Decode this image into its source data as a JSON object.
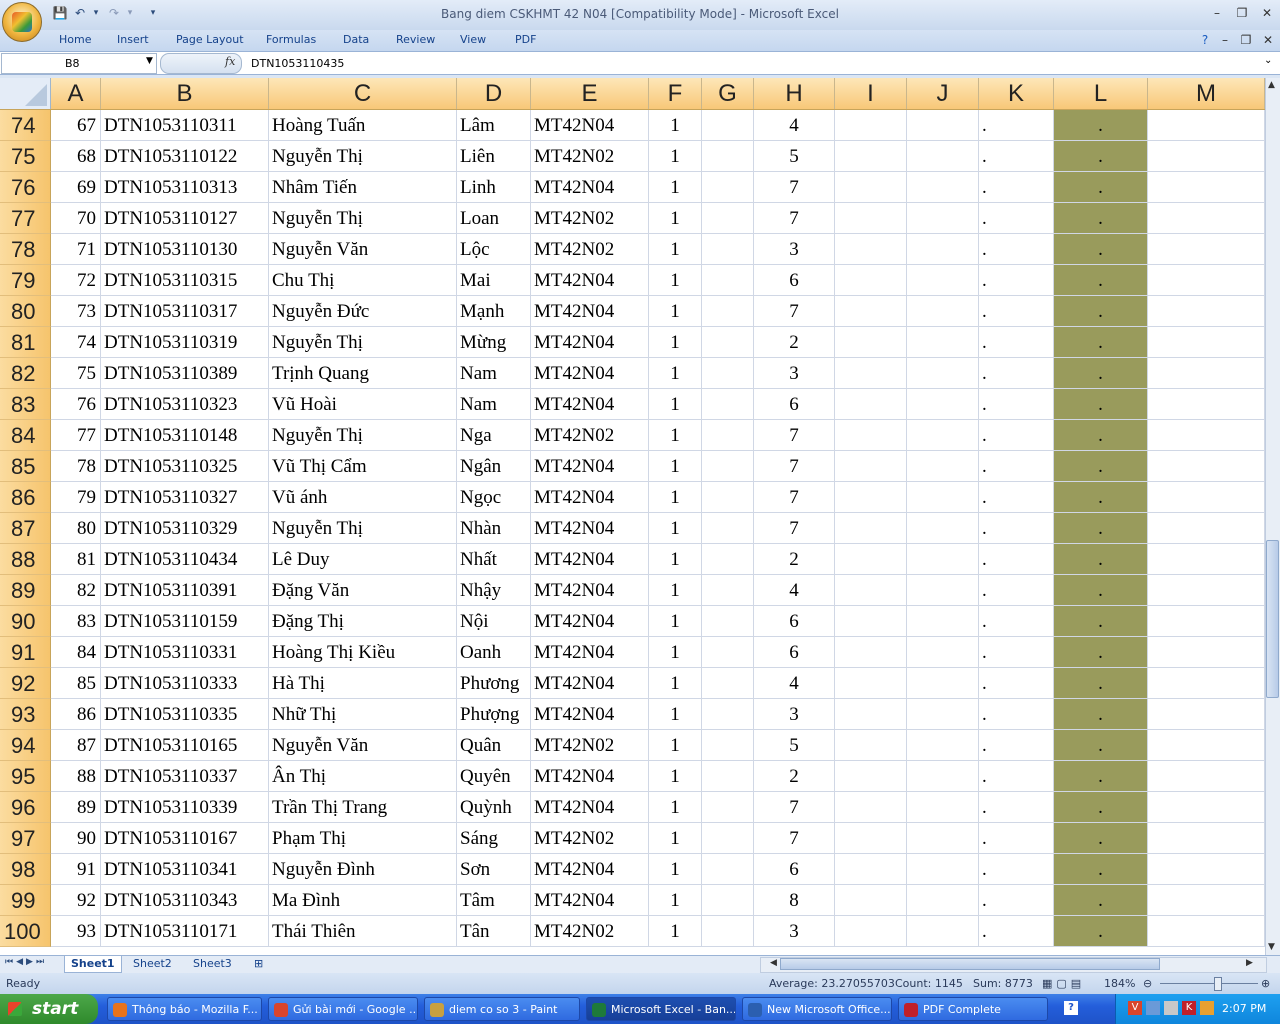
{
  "window": {
    "title": "Bang diem CSKHMT 42 N04  [Compatibility Mode] - Microsoft Excel"
  },
  "ribbon": {
    "tabs": [
      "Home",
      "Insert",
      "Page Layout",
      "Formulas",
      "Data",
      "Review",
      "View",
      "PDF"
    ]
  },
  "formula_bar": {
    "name_box": "B8",
    "fx_label": "fx",
    "value": "DTN1053110435"
  },
  "columns": [
    "A",
    "B",
    "C",
    "D",
    "E",
    "F",
    "G",
    "H",
    "I",
    "J",
    "K",
    "L",
    "M"
  ],
  "rows": [
    {
      "n": "74",
      "a": "67",
      "b": "DTN1053110311",
      "c": "Hoàng Tuấn",
      "d": "Lâm",
      "e": "MT42N04",
      "f": "1",
      "h": "4",
      "k": ".",
      "l": "."
    },
    {
      "n": "75",
      "a": "68",
      "b": "DTN1053110122",
      "c": "Nguyễn Thị",
      "d": "Liên",
      "e": "MT42N02",
      "f": "1",
      "h": "5",
      "k": ".",
      "l": "."
    },
    {
      "n": "76",
      "a": "69",
      "b": "DTN1053110313",
      "c": "Nhâm Tiến",
      "d": "Linh",
      "e": "MT42N04",
      "f": "1",
      "h": "7",
      "k": ".",
      "l": "."
    },
    {
      "n": "77",
      "a": "70",
      "b": "DTN1053110127",
      "c": "Nguyễn Thị",
      "d": "Loan",
      "e": "MT42N02",
      "f": "1",
      "h": "7",
      "k": ".",
      "l": "."
    },
    {
      "n": "78",
      "a": "71",
      "b": "DTN1053110130",
      "c": "Nguyễn Văn",
      "d": "Lộc",
      "e": "MT42N02",
      "f": "1",
      "h": "3",
      "k": ".",
      "l": "."
    },
    {
      "n": "79",
      "a": "72",
      "b": "DTN1053110315",
      "c": "Chu Thị",
      "d": "Mai",
      "e": "MT42N04",
      "f": "1",
      "h": "6",
      "k": ".",
      "l": "."
    },
    {
      "n": "80",
      "a": "73",
      "b": "DTN1053110317",
      "c": "Nguyễn Đức",
      "d": "Mạnh",
      "e": "MT42N04",
      "f": "1",
      "h": "7",
      "k": ".",
      "l": "."
    },
    {
      "n": "81",
      "a": "74",
      "b": "DTN1053110319",
      "c": "Nguyễn Thị",
      "d": "Mừng",
      "e": "MT42N04",
      "f": "1",
      "h": "2",
      "k": ".",
      "l": "."
    },
    {
      "n": "82",
      "a": "75",
      "b": "DTN1053110389",
      "c": "Trịnh Quang",
      "d": "Nam",
      "e": "MT42N04",
      "f": "1",
      "h": "3",
      "k": ".",
      "l": "."
    },
    {
      "n": "83",
      "a": "76",
      "b": "DTN1053110323",
      "c": "Vũ Hoài",
      "d": "Nam",
      "e": "MT42N04",
      "f": "1",
      "h": "6",
      "k": ".",
      "l": "."
    },
    {
      "n": "84",
      "a": "77",
      "b": "DTN1053110148",
      "c": "Nguyễn Thị",
      "d": "Nga",
      "e": "MT42N02",
      "f": "1",
      "h": "7",
      "k": ".",
      "l": "."
    },
    {
      "n": "85",
      "a": "78",
      "b": "DTN1053110325",
      "c": "Vũ Thị Cẩm",
      "d": "Ngân",
      "e": "MT42N04",
      "f": "1",
      "h": "7",
      "k": ".",
      "l": "."
    },
    {
      "n": "86",
      "a": "79",
      "b": "DTN1053110327",
      "c": "Vũ ánh",
      "d": "Ngọc",
      "e": "MT42N04",
      "f": "1",
      "h": "7",
      "k": ".",
      "l": "."
    },
    {
      "n": "87",
      "a": "80",
      "b": "DTN1053110329",
      "c": "Nguyễn Thị",
      "d": "Nhàn",
      "e": "MT42N04",
      "f": "1",
      "h": "7",
      "k": ".",
      "l": "."
    },
    {
      "n": "88",
      "a": "81",
      "b": "DTN1053110434",
      "c": "Lê Duy",
      "d": "Nhất",
      "e": "MT42N04",
      "f": "1",
      "h": "2",
      "k": ".",
      "l": "."
    },
    {
      "n": "89",
      "a": "82",
      "b": "DTN1053110391",
      "c": "Đặng Văn",
      "d": "Nhậy",
      "e": "MT42N04",
      "f": "1",
      "h": "4",
      "k": ".",
      "l": "."
    },
    {
      "n": "90",
      "a": "83",
      "b": "DTN1053110159",
      "c": "Đặng Thị",
      "d": "Nội",
      "e": "MT42N04",
      "f": "1",
      "h": "6",
      "k": ".",
      "l": "."
    },
    {
      "n": "91",
      "a": "84",
      "b": "DTN1053110331",
      "c": "Hoàng Thị Kiều",
      "d": "Oanh",
      "e": "MT42N04",
      "f": "1",
      "h": "6",
      "k": ".",
      "l": "."
    },
    {
      "n": "92",
      "a": "85",
      "b": "DTN1053110333",
      "c": "Hà Thị",
      "d": "Phương",
      "e": "MT42N04",
      "f": "1",
      "h": "4",
      "k": ".",
      "l": "."
    },
    {
      "n": "93",
      "a": "86",
      "b": "DTN1053110335",
      "c": "Nhữ Thị",
      "d": "Phượng",
      "e": "MT42N04",
      "f": "1",
      "h": "3",
      "k": ".",
      "l": "."
    },
    {
      "n": "94",
      "a": "87",
      "b": "DTN1053110165",
      "c": "Nguyễn Văn",
      "d": "Quân",
      "e": "MT42N02",
      "f": "1",
      "h": "5",
      "k": ".",
      "l": "."
    },
    {
      "n": "95",
      "a": "88",
      "b": "DTN1053110337",
      "c": "Ân Thị",
      "d": "Quyên",
      "e": "MT42N04",
      "f": "1",
      "h": "2",
      "k": ".",
      "l": "."
    },
    {
      "n": "96",
      "a": "89",
      "b": "DTN1053110339",
      "c": "Trần Thị Trang",
      "d": "Quỳnh",
      "e": "MT42N04",
      "f": "1",
      "h": "7",
      "k": ".",
      "l": "."
    },
    {
      "n": "97",
      "a": "90",
      "b": "DTN1053110167",
      "c": "Phạm Thị",
      "d": "Sáng",
      "e": "MT42N02",
      "f": "1",
      "h": "7",
      "k": ".",
      "l": "."
    },
    {
      "n": "98",
      "a": "91",
      "b": "DTN1053110341",
      "c": "Nguyễn Đình",
      "d": "Sơn",
      "e": "MT42N04",
      "f": "1",
      "h": "6",
      "k": ".",
      "l": "."
    },
    {
      "n": "99",
      "a": "92",
      "b": "DTN1053110343",
      "c": "Ma Đình",
      "d": "Tâm",
      "e": "MT42N04",
      "f": "1",
      "h": "8",
      "k": ".",
      "l": "."
    },
    {
      "n": "100",
      "a": "93",
      "b": "DTN1053110171",
      "c": "Thái Thiên",
      "d": "Tân",
      "e": "MT42N02",
      "f": "1",
      "h": "3",
      "k": ".",
      "l": "."
    }
  ],
  "sheets": [
    "Sheet1",
    "Sheet2",
    "Sheet3"
  ],
  "status": {
    "ready": "Ready",
    "average": "Average: 23.27055703",
    "count": "Count: 1145",
    "sum": "Sum: 8773",
    "zoom": "184%"
  },
  "taskbar": {
    "start": "start",
    "tasks": [
      {
        "label": "Thông báo - Mozilla F...",
        "color": "#e8731c"
      },
      {
        "label": "Gửi bài mới - Google ...",
        "color": "#d9452c"
      },
      {
        "label": "diem co so 3 - Paint",
        "color": "#c8a040"
      },
      {
        "label": "Microsoft Excel - Ban...",
        "color": "#1e7a3a",
        "active": true
      },
      {
        "label": "New Microsoft Office...",
        "color": "#2b5fb0"
      },
      {
        "label": "PDF Complete",
        "color": "#c0202a"
      }
    ],
    "clock": "2:07 PM"
  },
  "colors": {
    "highlight_column_L": "#999b5c",
    "header_orange": "#f8c878"
  }
}
